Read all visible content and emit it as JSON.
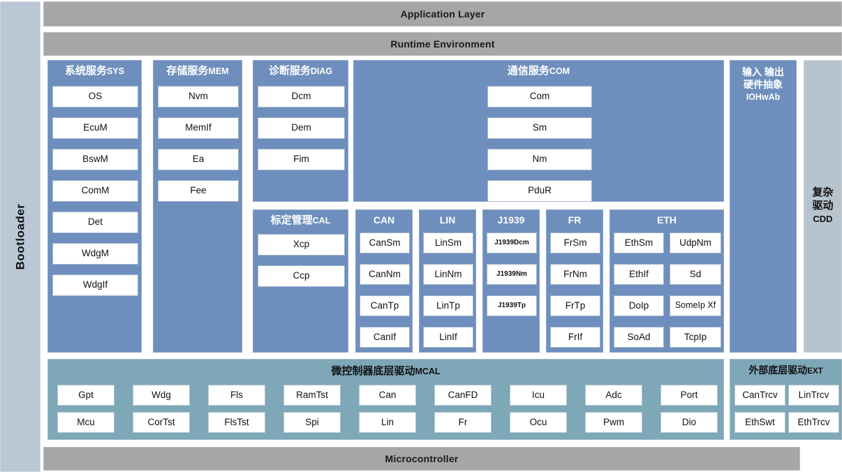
{
  "layers": {
    "application": "Application Layer",
    "rte": "Runtime Environment",
    "microcontroller": "Microcontroller",
    "bootloader": "Bootloader"
  },
  "colors": {
    "gray_bar": "#a6a6a6",
    "service_blue": "#6e8fbd",
    "bootloader_blue": "#b9c8d4",
    "cdd_gray": "#b7c4cd",
    "mcal_teal": "#7ea7b8",
    "chip_white": "#ffffff"
  },
  "services": [
    {
      "id": "sys",
      "title_cn": "系统服务",
      "title_abbr": "SYS",
      "modules": [
        "OS",
        "EcuM",
        "BswM",
        "ComM",
        "Det",
        "WdgM",
        "WdgIf"
      ]
    },
    {
      "id": "mem",
      "title_cn": "存储服务",
      "title_abbr": "MEM",
      "modules": [
        "Nvm",
        "MemIf",
        "Ea",
        "Fee"
      ]
    },
    {
      "id": "diag",
      "title_cn": "诊断服务",
      "title_abbr": "DIAG",
      "modules": [
        "Dcm",
        "Dem",
        "Fim"
      ]
    },
    {
      "id": "com",
      "title_cn": "通信服务",
      "title_abbr": "COM",
      "modules": [
        "Com",
        "Sm",
        "Nm",
        "PduR"
      ]
    },
    {
      "id": "cal",
      "title_cn": "标定管理",
      "title_abbr": "CAL",
      "modules": [
        "Xcp",
        "Ccp"
      ]
    }
  ],
  "buses": [
    {
      "id": "can",
      "title": "CAN",
      "modules": [
        "CanSm",
        "CanNm",
        "CanTp",
        "CanIf"
      ]
    },
    {
      "id": "lin",
      "title": "LIN",
      "modules": [
        "LinSm",
        "LinNm",
        "LinTp",
        "LinIf"
      ]
    },
    {
      "id": "j1939",
      "title": "J1939",
      "modules": [
        "J1939Dcm",
        "J1939Nm",
        "J1939Tp"
      ]
    },
    {
      "id": "fr",
      "title": "FR",
      "modules": [
        "FrSm",
        "FrNm",
        "FrTp",
        "FrIf"
      ]
    },
    {
      "id": "eth",
      "title": "ETH",
      "col_left": [
        "EthSm",
        "EthIf",
        "DoIp",
        "SoAd"
      ],
      "col_right": [
        "UdpNm",
        "Sd",
        "SomeIp Xf",
        "TcpIp"
      ]
    }
  ],
  "iohwab": {
    "title_line1": "输入 输出",
    "title_line2": "硬件抽象",
    "title_abbr": "IOHwAb"
  },
  "cdd": {
    "title_line1": "复杂",
    "title_line2": "驱动",
    "title_abbr": "CDD"
  },
  "mcal": {
    "title_cn": "微控制器底层驱动",
    "title_abbr": "MCAL",
    "row_top": [
      "Gpt",
      "Wdg",
      "Fls",
      "RamTst",
      "Can",
      "CanFD",
      "Icu",
      "Adc",
      "Port"
    ],
    "row_bottom": [
      "Mcu",
      "CorTst",
      "FlsTst",
      "Spi",
      "Lin",
      "Fr",
      "Ocu",
      "Pwm",
      "Dio"
    ]
  },
  "ext": {
    "title_cn": "外部底层驱动",
    "title_abbr": "EXT",
    "row_top": [
      "CanTrcv",
      "LinTrcv"
    ],
    "row_bottom": [
      "EthSwt",
      "EthTrcv"
    ]
  }
}
